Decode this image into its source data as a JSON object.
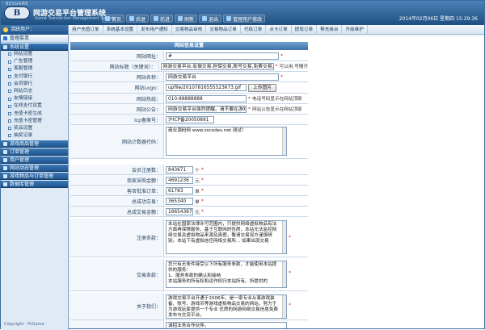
{
  "header": {
    "brand": "BESGAME",
    "title": "网游交易平台管理系统",
    "subtitle": "Game Transaction Management System",
    "nav": [
      {
        "label": "首页",
        "icon": "home-icon"
      },
      {
        "label": "后退",
        "icon": "back-icon"
      },
      {
        "label": "前进",
        "icon": "forward-icon"
      },
      {
        "label": "刷新",
        "icon": "refresh-icon"
      },
      {
        "label": "退出",
        "icon": "logout-icon"
      },
      {
        "label": "管理用户修改",
        "icon": "user-edit-icon"
      }
    ],
    "datetime": "2014年02月06日 星期四 15:29:36"
  },
  "tabs": [
    "用户充值订单",
    "系统基本设置",
    "发布用户通知",
    "交易物品审核",
    "交易物品订单",
    "代练订单",
    "点卡订单",
    "提现订单",
    "帮充商台",
    "升级维护"
  ],
  "sidebar": {
    "user_label": "活跃用户：",
    "section_title": "管理菜单",
    "groups": [
      {
        "title": "系统设置",
        "items": [
          "网站设置",
          "广告管理",
          "客服管理",
          "支付银行",
          "会员银行",
          "网站日志",
          "友情链接",
          "在线支付设置",
          "充值卡密生成",
          "充值卡密管理",
          "奖品设置",
          "抽奖记录"
        ]
      },
      {
        "title": "游戏商品管理",
        "items": []
      },
      {
        "title": "订单管理",
        "items": []
      },
      {
        "title": "用户管理",
        "items": []
      },
      {
        "title": "网站动态管理",
        "items": []
      },
      {
        "title": "游戏物品与订单管理",
        "items": []
      },
      {
        "title": "数据库管理",
        "items": []
      }
    ],
    "copyright": "Copyright · PsGame"
  },
  "form": {
    "title": "网站信息设置",
    "site_url": {
      "label": "网站网址：",
      "value": "#"
    },
    "keywords": {
      "label": "网站标题（关键词）：",
      "value": "网游交易平台,有偿交易,担保交易,账号交易,免费交易,网游交",
      "hint": "可以用,号隔开"
    },
    "site_name": {
      "label": "网站名称：",
      "value": "网游交易平台"
    },
    "logo": {
      "label": "网站Logo：",
      "value": "upfile/20107816555523673.gif",
      "button": "上传图片"
    },
    "phone": {
      "label": "网站热线：",
      "value": "010-88888888",
      "hint": "电话号码显示在网站顶部"
    },
    "notice": {
      "label": "网站公告：",
      "value": "网游交易平台强烈提醒。请不要在游戏",
      "hint": "网站公告显示在网站顶部"
    },
    "icp": {
      "label": "Icp备案号：",
      "value": "沪ICP备20050891"
    },
    "stats_code": {
      "label": "网站计数器代码：",
      "value": "商业源码网 www.zscodes.net 测试！"
    },
    "members": {
      "label": "会员注册数：",
      "value": "843671",
      "unit": "个"
    },
    "buy_count": {
      "label": "我家采购金额：",
      "value": "4691236",
      "unit": "元"
    },
    "deals": {
      "label": "客官批准订单：",
      "value": "61783",
      "unit": "单"
    },
    "total_orders": {
      "label": "总成功交易：",
      "value": "365340",
      "unit": "单"
    },
    "total_amount": {
      "label": "总成交易金额：",
      "value": "16654387",
      "unit": "元"
    },
    "agreement": {
      "label": "注册条款：",
      "value": "本站在国家法律许可范围内，只提供网络虚拟物品有法方面再保障服务，基于互联网的性质，本站无法监控网络交易及虚拟物品来源及真假，敬请交易双方谨慎辨别。本站下有虚拟信任网络交易所... 如果出现交易"
    },
    "trade_terms": {
      "label": "交易条款：",
      "value": "您只有无条件接受以下所有服务条款，才能使用本站提供的服务：\n1、服务条款的确认和接纳\n本站服务的所有权和运作权归本站所有。所提供的"
    },
    "about": {
      "label": "关于我们：",
      "value": "游戏交易平台开通于2006年，是一家专业从事游戏装备、账号、游戏币等游戏虚拟物品交易的网站，努力于为游戏玩家提供一个专业 优质的网游网络交易信息免费发布与交流平台。"
    },
    "cooperation": {
      "label": "",
      "value": "诚招业务合作伙伴。"
    }
  }
}
